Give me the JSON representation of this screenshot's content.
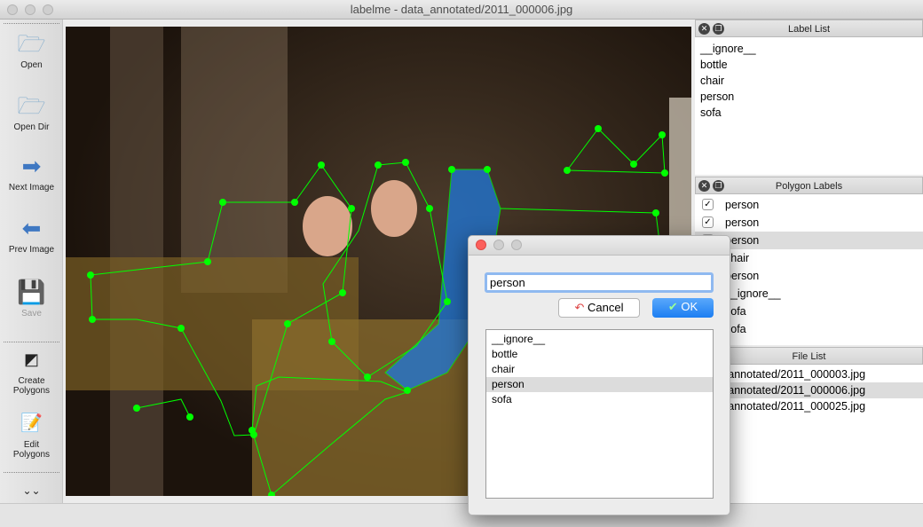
{
  "window": {
    "title": "labelme - data_annotated/2011_000006.jpg"
  },
  "toolbar": {
    "items": [
      {
        "label": "Open",
        "icon": "folder-open-icon"
      },
      {
        "label": "Open Dir",
        "icon": "folder-open-icon"
      },
      {
        "label": "Next Image",
        "icon": "arrow-right-icon"
      },
      {
        "label": "Prev Image",
        "icon": "arrow-left-icon"
      },
      {
        "label": "Save",
        "icon": "floppy-disk-icon",
        "disabled": true
      },
      {
        "label": "Create\nPolygons",
        "icon": "create-polygon-icon"
      },
      {
        "label": "Edit\nPolygons",
        "icon": "edit-icon"
      }
    ]
  },
  "label_list": {
    "title": "Label List",
    "items": [
      "__ignore__",
      "bottle",
      "chair",
      "person",
      "sofa"
    ]
  },
  "polygon_labels": {
    "title": "Polygon Labels",
    "items": [
      {
        "label": "person",
        "checked": true
      },
      {
        "label": "person",
        "checked": true
      },
      {
        "label": "person",
        "checked": true,
        "selected": true
      },
      {
        "label": "chair",
        "checked": true
      },
      {
        "label": "person",
        "checked": true
      },
      {
        "label": "__ignore__",
        "checked": true
      },
      {
        "label": "sofa",
        "checked": true
      },
      {
        "label": "sofa",
        "checked": true
      }
    ]
  },
  "file_list": {
    "title": "File List",
    "items": [
      {
        "name": "data_annotated/2011_000003.jpg"
      },
      {
        "name": "data_annotated/2011_000006.jpg",
        "selected": true
      },
      {
        "name": "data_annotated/2011_000025.jpg"
      }
    ]
  },
  "dialog": {
    "input_value": "person",
    "cancel_label": "Cancel",
    "ok_label": "OK",
    "items": [
      "__ignore__",
      "bottle",
      "chair",
      "person",
      "sofa"
    ],
    "selected": "person"
  },
  "colors": {
    "polygon": "#00ff00",
    "selected_fill": "#1e78dc",
    "accent": "#2f8df7"
  }
}
